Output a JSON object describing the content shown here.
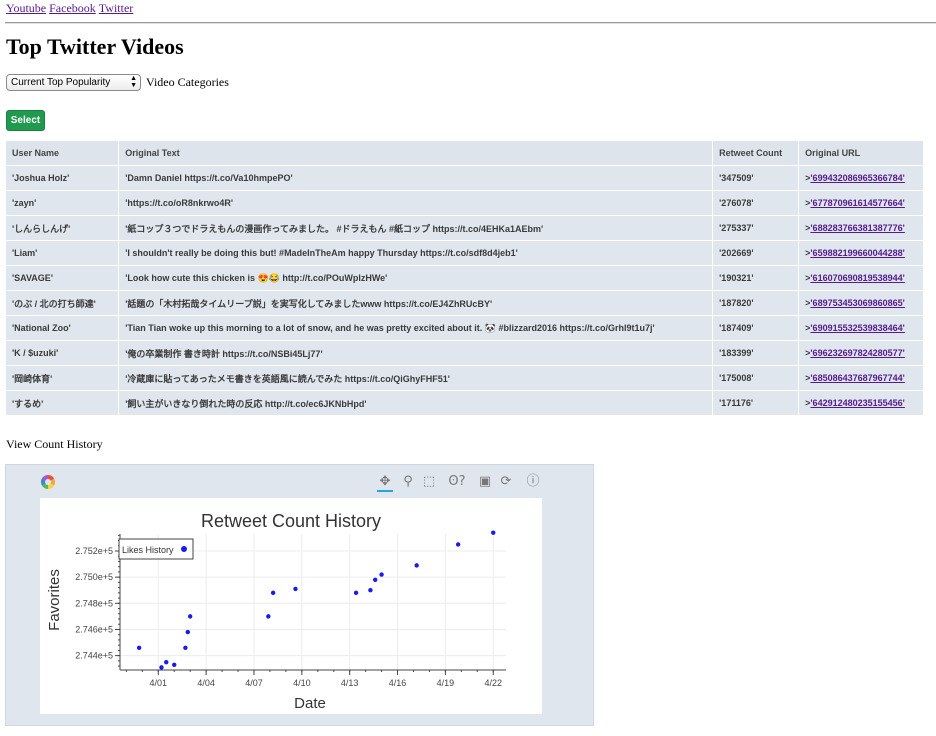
{
  "nav": {
    "links": [
      "Youtube",
      "Facebook",
      "Twitter"
    ]
  },
  "page_title": "Top Twitter Videos",
  "filter": {
    "selected": "Current Top Popularity",
    "label": "Video Categories"
  },
  "select_button": "Select",
  "table": {
    "headers": [
      "User Name",
      "Original Text",
      "Retweet Count",
      "Original URL"
    ],
    "rows": [
      [
        "'Joshua Holz'",
        "'Damn Daniel https://t.co/Va10hmpePO'",
        "'347509'",
        "'699432086965366784'"
      ],
      [
        "'zayn'",
        "'https://t.co/oR8nkrwo4R'",
        "'276078'",
        "'677870961614577664'"
      ],
      [
        "'しんらしんげ'",
        "'紙コップ３つでドラえもんの漫画作ってみました。 #ドラえもん #紙コップ https://t.co/4EHKa1AEbm'",
        "'275337'",
        "'688283766381387776'"
      ],
      [
        "'Liam'",
        "'I shouldn't really be doing this but! #MadeInTheAm happy Thursday https://t.co/sdf8d4jeb1'",
        "'202669'",
        "'659882199660044288'"
      ],
      [
        "'SAVAGE'",
        "'Look how cute this chicken is 😍😂 http://t.co/POuWplzHWe'",
        "'190321'",
        "'616070690819538944'"
      ],
      [
        "'のぶ / 北の打ち師達'",
        "'話題の「木村拓哉タイムリープ説」を実写化してみましたwww https://t.co/EJ4ZhRUcBY'",
        "'187820'",
        "'689753453069860865'"
      ],
      [
        "'National Zoo'",
        "'Tian Tian woke up this morning to a lot of snow, and he was pretty excited about it. 🐼 #blizzard2016 https://t.co/Grhl9t1u7j'",
        "'187409'",
        "'690915532539838464'"
      ],
      [
        "'K / $uzuki'",
        "'俺の卒業制作 書き時計 https://t.co/NSBi45Lj77'",
        "'183399'",
        "'696232697824280577'"
      ],
      [
        "'岡崎体育'",
        "'冷蔵庫に貼ってあったメモ書きを英語風に読んでみた https://t.co/QiGhyFHF51'",
        "'175008'",
        "'685086437687967744'"
      ],
      [
        "'するめ'",
        "'飼い主がいきなり倒れた時の反応 http://t.co/ec6JKNbHpd'",
        "'171176'",
        "'642912480235155456'"
      ]
    ],
    "url_prefix": ">"
  },
  "history_label": "View Count History",
  "toolbar_icons": [
    "pan-icon",
    "wheel-zoom-icon",
    "box-zoom-icon",
    "lasso-icon",
    "save-icon",
    "reset-icon",
    "help-icon"
  ],
  "chart_data": {
    "type": "scatter",
    "title": "Retweet Count History",
    "xlabel": "Date",
    "ylabel": "Favorites",
    "x_ticks": [
      "4/01",
      "4/04",
      "4/07",
      "4/10",
      "4/13",
      "4/16",
      "4/19",
      "4/22"
    ],
    "x_tick_values": [
      1,
      4,
      7,
      10,
      13,
      16,
      19,
      22
    ],
    "y_ticks": [
      "2.744e+5",
      "2.746e+5",
      "2.748e+5",
      "2.750e+5",
      "2.752e+5"
    ],
    "y_tick_values": [
      274400,
      274600,
      274800,
      275000,
      275200
    ],
    "xlim": [
      -1.4,
      22.8
    ],
    "ylim": [
      274290,
      275330
    ],
    "legend": {
      "label": "Likes History",
      "position": "top-left"
    },
    "grid": true,
    "series": [
      {
        "name": "Likes History",
        "color": "#1a1aee",
        "x": [
          -0.2,
          1.2,
          1.5,
          2.0,
          2.7,
          2.85,
          3.0,
          7.9,
          8.2,
          9.6,
          13.4,
          14.3,
          14.6,
          15.0,
          17.2,
          19.8,
          22.0
        ],
        "y": [
          274460,
          274310,
          274350,
          274330,
          274460,
          274580,
          274700,
          274700,
          274880,
          274910,
          274880,
          274900,
          274980,
          275020,
          275090,
          275250,
          275340
        ]
      }
    ]
  }
}
